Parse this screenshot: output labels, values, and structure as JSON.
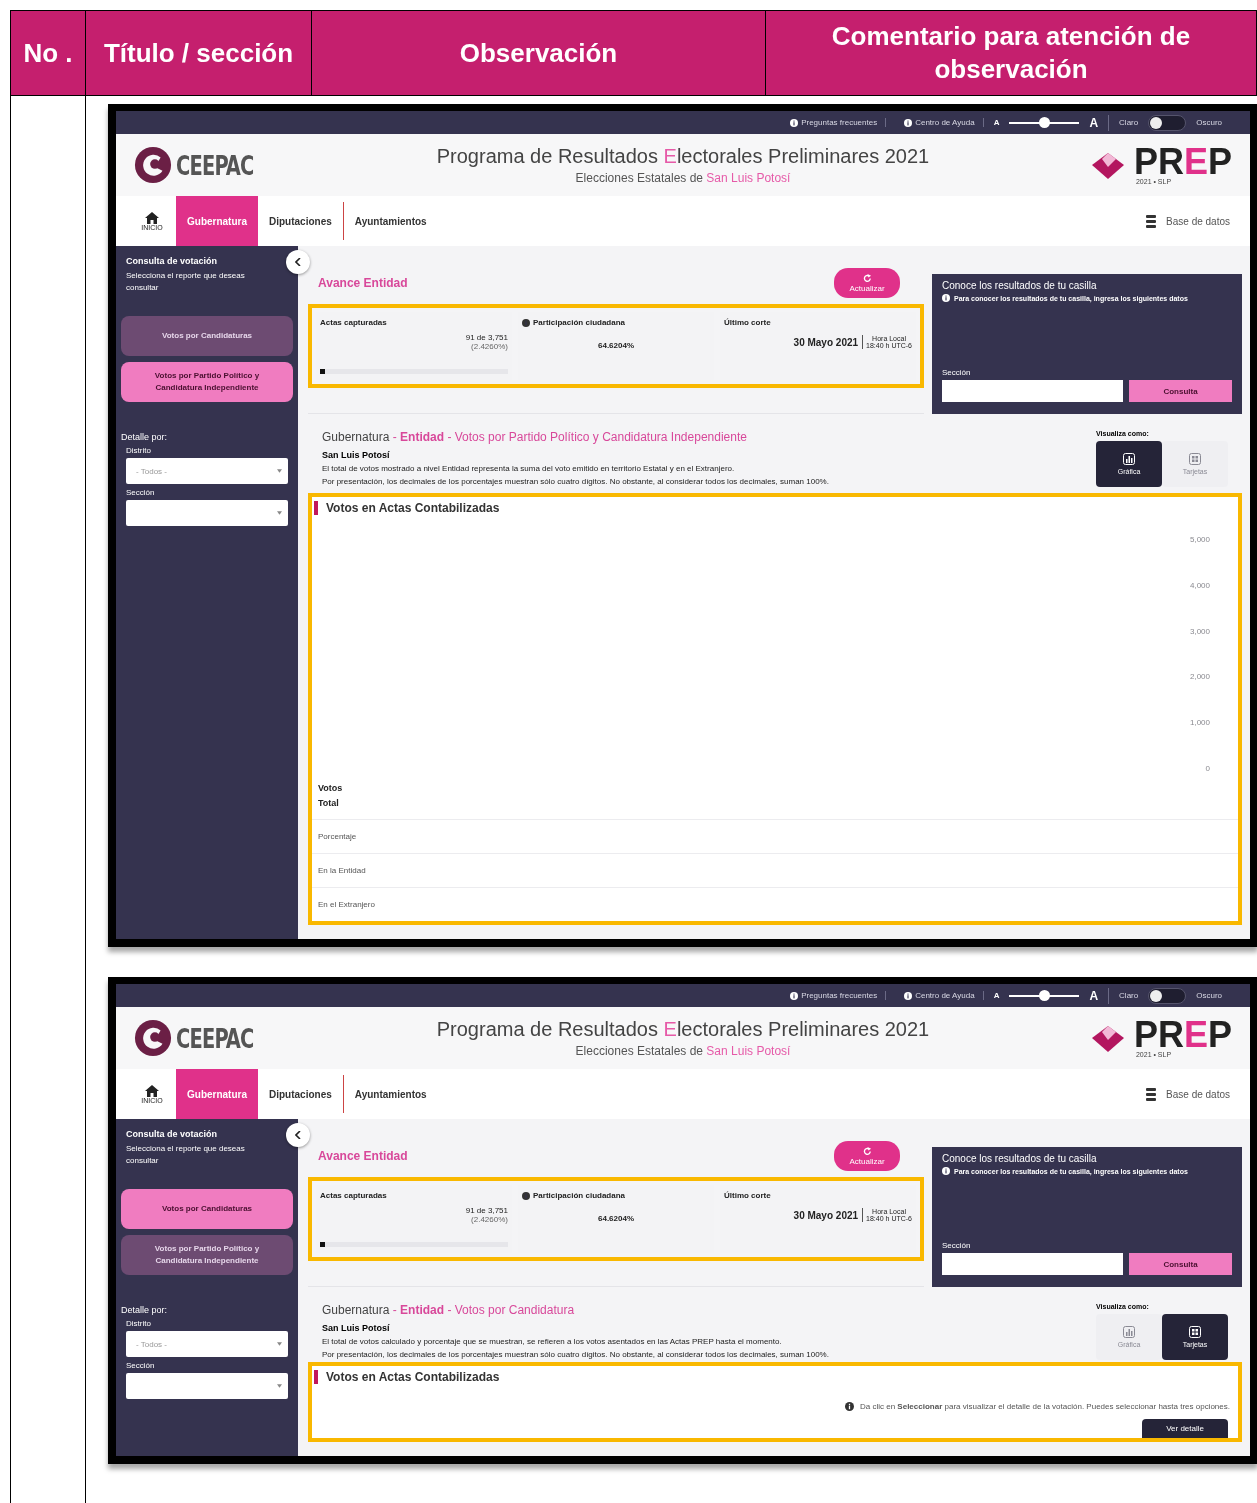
{
  "table": {
    "columns": [
      "No .",
      "Título / sección",
      "Observación",
      "Comentario para atención de observación"
    ]
  },
  "screenshots": [
    {
      "topbar": {
        "links": [
          "Preguntas frecuentes",
          "Centro de Ayuda"
        ],
        "font_size": {
          "small": "A",
          "large": "A",
          "level": 0.5
        },
        "theme": {
          "light": "Claro",
          "dark_label": "Oscuro",
          "dark": false
        }
      },
      "header": {
        "logo": "CEEPAC",
        "title": [
          {
            "text": "Programa de Resultados ",
            "accent": false
          },
          {
            "text": "E",
            "accent": true
          },
          {
            "text": "lectorales Preliminares 2021",
            "accent": false
          }
        ],
        "subtitle": [
          {
            "text": "Elecciones Estatales de ",
            "accent": false
          },
          {
            "text": "San Luis Potosí",
            "accent": true
          }
        ],
        "prep": [
          {
            "text": "PR",
            "accent": false
          },
          {
            "text": "E",
            "accent": true
          },
          {
            "text": "P",
            "accent": false
          }
        ],
        "prep_caption": "2021 • SLP"
      },
      "nav": {
        "home": "INICIO",
        "tabs": [
          {
            "label": "Gubernatura",
            "selected": true
          },
          {
            "label": "Diputaciones",
            "selected": false
          },
          {
            "label": "Ayuntamientos",
            "selected": false
          }
        ],
        "database": "Base de datos"
      },
      "sidebar": {
        "title": "Consulta de votación",
        "subtitle": "Selecciona el reporte que deseas consultar",
        "reports": [
          {
            "label": "Votos por Candidaturas",
            "selected": false
          },
          {
            "label": "Votos por Partido Político y Candidatura Independiente",
            "selected": true
          }
        ],
        "detail_label": "Detalle por:",
        "filters": [
          {
            "label": "Distrito",
            "placeholder": "- Todos -"
          },
          {
            "label": "Sección"
          }
        ]
      },
      "avance": {
        "title": "Avance Entidad",
        "refresh": "Actualizar",
        "highlighted": true,
        "actas": {
          "label": "Actas capturadas",
          "count": "91 de 3,751",
          "percent": "(2.4260%)",
          "level": 0.024
        },
        "participacion": {
          "label": "Participación ciudadana",
          "value": "64.6204%"
        },
        "corte": {
          "label": "Último corte",
          "date": "30 Mayo 2021",
          "time_label": "Hora Local",
          "time": "18:40 h UTC-6"
        }
      },
      "casilla": {
        "title": "Conoce los resultados de tu casilla",
        "hint": "Para conocer los resultados de tu casilla, ingresa los siguientes datos",
        "field_label": "Sección",
        "button": "Consulta"
      },
      "section": {
        "breadcrumb": [
          {
            "text": "Gubernatura",
            "kind": "plain"
          },
          {
            "text": " - ",
            "kind": "accent"
          },
          {
            "text": "Entidad",
            "kind": "strong"
          },
          {
            "text": " - Votos por Partido Político y Candidatura Independiente",
            "kind": "accent"
          }
        ],
        "location": "San Luis Potosí",
        "notes": [
          "El total de votos mostrado a nivel Entidad representa la suma del voto emitido en territorio Estatal y en el Extranjero.",
          "Por presentación, los decimales de los porcentajes muestran sólo cuatro dígitos. No obstante, al considerar todos los decimales, suman 100%."
        ],
        "view_label": "Visualiza como:",
        "views": [
          {
            "label": "Gráfica",
            "kind": "chart",
            "selected": true
          },
          {
            "label": "Tarjetas",
            "kind": "cards",
            "selected": false
          }
        ]
      },
      "results": {
        "title": "Votos en Actas Contabilizadas",
        "highlighted": true,
        "kind": "chart",
        "y_labels": [
          "5,000",
          "4,000",
          "3,000",
          "2,000",
          "1,000",
          "0"
        ],
        "row_headers": [
          "Votos",
          "Total"
        ],
        "rows": [
          "Porcentaje",
          "En la Entidad",
          "En el Extranjero"
        ]
      }
    },
    {
      "topbar": {
        "links": [
          "Preguntas frecuentes",
          "Centro de Ayuda"
        ],
        "font_size": {
          "small": "A",
          "large": "A",
          "level": 0.5
        },
        "theme": {
          "light": "Claro",
          "dark_label": "Oscuro",
          "dark": false
        }
      },
      "header": {
        "logo": "CEEPAC",
        "title": [
          {
            "text": "Programa de Resultados ",
            "accent": false
          },
          {
            "text": "E",
            "accent": true
          },
          {
            "text": "lectorales Preliminares 2021",
            "accent": false
          }
        ],
        "subtitle": [
          {
            "text": "Elecciones Estatales de ",
            "accent": false
          },
          {
            "text": "San Luis Potosí",
            "accent": true
          }
        ],
        "prep": [
          {
            "text": "PR",
            "accent": false
          },
          {
            "text": "E",
            "accent": true
          },
          {
            "text": "P",
            "accent": false
          }
        ],
        "prep_caption": "2021 • SLP"
      },
      "nav": {
        "home": "INICIO",
        "tabs": [
          {
            "label": "Gubernatura",
            "selected": true
          },
          {
            "label": "Diputaciones",
            "selected": false
          },
          {
            "label": "Ayuntamientos",
            "selected": false
          }
        ],
        "database": "Base de datos"
      },
      "sidebar": {
        "title": "Consulta de votación",
        "subtitle": "Selecciona el reporte que deseas consultar",
        "reports": [
          {
            "label": "Votos por Candidaturas",
            "selected": true
          },
          {
            "label": "Votos por Partido Político y Candidatura Independiente",
            "selected": false
          }
        ],
        "detail_label": "Detalle por:",
        "filters": [
          {
            "label": "Distrito",
            "placeholder": "- Todos -"
          },
          {
            "label": "Sección"
          }
        ]
      },
      "avance": {
        "title": "Avance Entidad",
        "refresh": "Actualizar",
        "highlighted": true,
        "actas": {
          "label": "Actas capturadas",
          "count": "91 de 3,751",
          "percent": "(2.4260%)",
          "level": 0.024
        },
        "participacion": {
          "label": "Participación ciudadana",
          "value": "64.6204%"
        },
        "corte": {
          "label": "Último corte",
          "date": "30 Mayo 2021",
          "time_label": "Hora Local",
          "time": "18:40 h UTC-6"
        }
      },
      "casilla": {
        "title": "Conoce los resultados de tu casilla",
        "hint": "Para conocer los resultados de tu casilla, ingresa los siguientes datos",
        "field_label": "Sección",
        "button": "Consulta"
      },
      "section": {
        "breadcrumb": [
          {
            "text": "Gubernatura",
            "kind": "plain"
          },
          {
            "text": " - ",
            "kind": "accent"
          },
          {
            "text": "Entidad",
            "kind": "strong"
          },
          {
            "text": " - Votos por Candidatura",
            "kind": "accent"
          }
        ],
        "location": "San Luis Potosí",
        "notes": [
          "El total de votos calculado y porcentaje que se muestran, se refieren a los votos asentados en las Actas PREP hasta el momento.",
          "Por presentación, los decimales de los porcentajes muestran sólo cuatro dígitos. No obstante, al considerar todos los decimales, suman 100%."
        ],
        "view_label": "Visualiza como:",
        "views": [
          {
            "label": "Gráfica",
            "kind": "chart",
            "selected": false
          },
          {
            "label": "Tarjetas",
            "kind": "cards",
            "selected": true
          }
        ]
      },
      "results": {
        "title": "Votos en Actas Contabilizadas",
        "highlighted": true,
        "kind": "cards",
        "info": "Da clic en **Seleccionar** para visualizar el detalle de la votación. Puedes seleccionar hasta tres opciones.",
        "button": "Ver detalle"
      }
    }
  ]
}
